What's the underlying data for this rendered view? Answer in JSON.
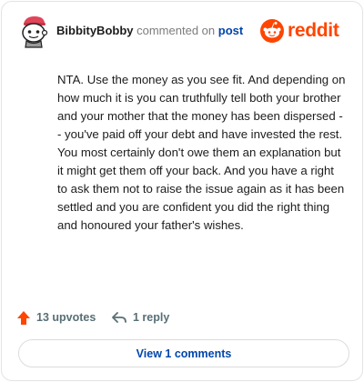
{
  "header": {
    "username": "BibbityBobby",
    "action_text": "commented on",
    "post_link": "post",
    "brand_wordmark": "reddit",
    "brand_color": "#ff4500",
    "avatar_icon": "snoo-avatar-icon"
  },
  "comment": {
    "text": "NTA. Use the money as you see fit. And depending on how much it is you can truthfully tell both your brother and your mother that the money has been dispersed -- you've paid off your debt and have invested the rest. You most certainly don't owe them an explanation but it might get them off your back. And you have a right to ask them not to raise the issue again as it has been settled and you are confident you did the right thing and honoured your father's wishes."
  },
  "actions": {
    "upvotes_label": "13 upvotes",
    "upvote_icon": "upvote-arrow-icon",
    "upvote_color": "#ff4500",
    "reply_label": "1 reply",
    "reply_icon": "reply-arrow-icon"
  },
  "footer": {
    "view_comments_label": "View 1 comments",
    "link_color": "#0045ac"
  }
}
